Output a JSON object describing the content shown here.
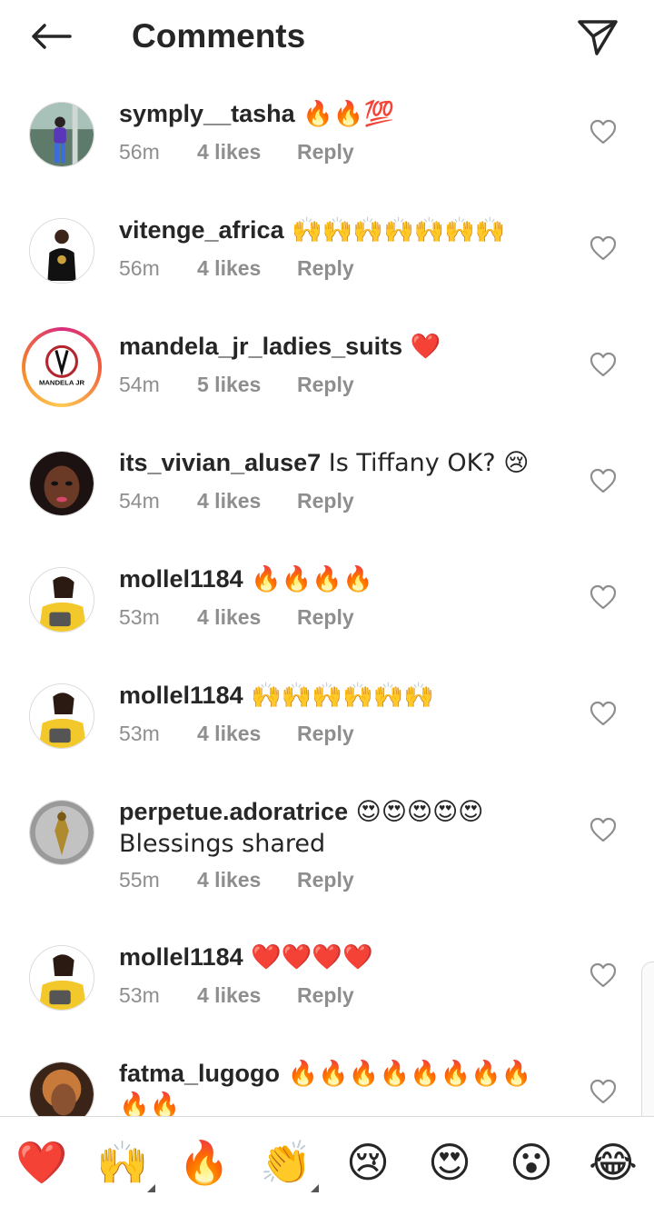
{
  "header": {
    "title": "Comments"
  },
  "icons": {
    "back": "back-arrow-icon",
    "share": "send-paper-plane-icon",
    "like": "heart-outline-icon"
  },
  "colors": {
    "text": "#262626",
    "muted": "#8e8e8e",
    "divider": "#dbdbdb",
    "story_ring": "#d82d7e"
  },
  "comments": [
    {
      "username": "symply__tasha",
      "text": " 🔥🔥💯",
      "time": "56m",
      "likes": "4 likes",
      "reply": "Reply"
    },
    {
      "username": "vitenge_africa",
      "text": " 🙌🙌🙌🙌🙌🙌🙌",
      "time": "56m",
      "likes": "4 likes",
      "reply": "Reply"
    },
    {
      "username": "mandela_jr_ladies_suits",
      "text": " ❤️",
      "time": "54m",
      "likes": "5 likes",
      "reply": "Reply",
      "avatar_text": "MANDELA JR"
    },
    {
      "username": "its_vivian_aluse7",
      "text": " Is Tiffany OK? 😢",
      "time": "54m",
      "likes": "4 likes",
      "reply": "Reply"
    },
    {
      "username": "mollel1184",
      "text": " 🔥🔥🔥🔥",
      "time": "53m",
      "likes": "4 likes",
      "reply": "Reply"
    },
    {
      "username": "mollel1184",
      "text": " 🙌🙌🙌🙌🙌🙌",
      "time": "53m",
      "likes": "4 likes",
      "reply": "Reply"
    },
    {
      "username": "perpetue.adoratrice",
      "text": " 😍😍😍😍😍 Blessings shared",
      "time": "55m",
      "likes": "4 likes",
      "reply": "Reply"
    },
    {
      "username": "mollel1184",
      "text": " ❤️❤️❤️❤️",
      "time": "53m",
      "likes": "4 likes",
      "reply": "Reply"
    },
    {
      "username": "fatma_lugogo",
      "text": " 🔥🔥🔥🔥🔥🔥🔥🔥🔥🔥",
      "time": "",
      "likes": "",
      "reply": ""
    }
  ],
  "emoji_bar": [
    "❤️",
    "🙌",
    "🔥",
    "👏",
    "😢",
    "😍",
    "😮",
    "😂"
  ]
}
